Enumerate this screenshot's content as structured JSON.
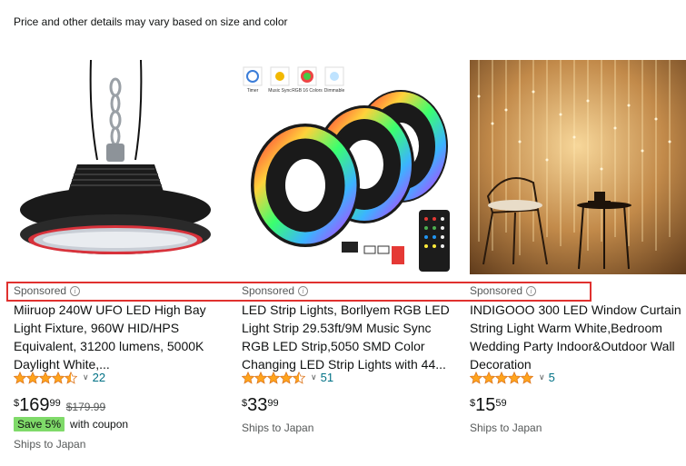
{
  "notice": "Price and other details may vary based on size and color",
  "products": [
    {
      "sponsored": "Sponsored",
      "title_lines": [
        "Miiruop 240W UFO LED High Bay",
        "Light Fixture, 960W HID/HPS",
        "Equivalent, 31200 lumens, 5000K",
        "Daylight White,..."
      ],
      "rating": 4.5,
      "review_count": "22",
      "price_symbol": "$",
      "price_whole": "169",
      "price_fraction": "99",
      "list_price": "$179.99",
      "coupon_badge": "Save 5%",
      "coupon_text": "with coupon",
      "shipping": "Ships to Japan"
    },
    {
      "sponsored": "Sponsored",
      "title_lines": [
        "LED Strip Lights, Borllyem RGB LED",
        "Light Strip 29.53ft/9M Music Sync",
        "RGB LED Strip,5050 SMD Color",
        "Changing LED Strip Lights with 44..."
      ],
      "rating": 4.5,
      "review_count": "51",
      "price_symbol": "$",
      "price_whole": "33",
      "price_fraction": "99",
      "shipping": "Ships to Japan"
    },
    {
      "sponsored": "Sponsored",
      "title_lines": [
        "INDIGOOO 300 LED Window Curtain",
        "String Light Warm White,Bedroom",
        "Wedding Party Indoor&Outdoor Wall",
        "Decoration"
      ],
      "rating": 5,
      "review_count": "5",
      "price_symbol": "$",
      "price_whole": "15",
      "price_fraction": "59",
      "shipping": "Ships to Japan"
    }
  ],
  "strip_icon_labels": [
    "Timer",
    "Music Sync",
    "RGB 16 Colors",
    "Dimmable"
  ],
  "colors": {
    "star": "#ffa41c",
    "link": "#007185",
    "highlight": "#e0312f",
    "coupon": "#7fda69"
  }
}
